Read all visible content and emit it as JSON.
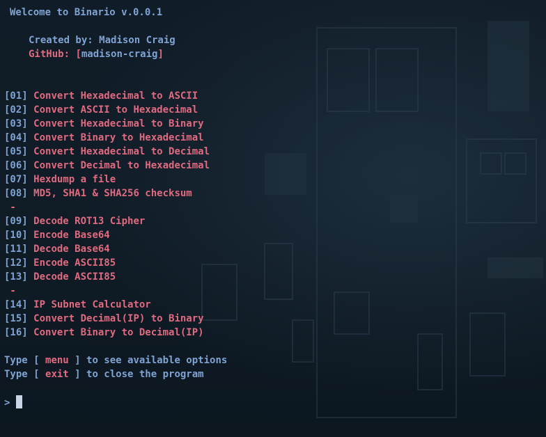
{
  "header": {
    "welcome": "Welcome to Binario v.0.0.1",
    "created_by": "Created by: Madison Craig",
    "github_label": "GitHub: ",
    "github_open": "[",
    "github_user": "madison-craig",
    "github_close": "]"
  },
  "menu": {
    "items": [
      {
        "number": "[01]",
        "label": "Convert Hexadecimal to ASCII"
      },
      {
        "number": "[02]",
        "label": "Convert ASCII to Hexadecimal"
      },
      {
        "number": "[03]",
        "label": "Convert Hexadecimal to Binary"
      },
      {
        "number": "[04]",
        "label": "Convert Binary to Hexadecimal"
      },
      {
        "number": "[05]",
        "label": "Convert Hexadecimal to Decimal"
      },
      {
        "number": "[06]",
        "label": "Convert Decimal to Hexadecimal"
      },
      {
        "number": "[07]",
        "label": "Hexdump a file"
      },
      {
        "number": "[08]",
        "label": "MD5, SHA1 & SHA256 checksum"
      },
      {
        "number": "[09]",
        "label": "Decode ROT13 Cipher"
      },
      {
        "number": "[10]",
        "label": "Encode Base64"
      },
      {
        "number": "[11]",
        "label": "Decode Base64"
      },
      {
        "number": "[12]",
        "label": "Encode ASCII85"
      },
      {
        "number": "[13]",
        "label": "Decode ASCII85"
      },
      {
        "number": "[14]",
        "label": "IP Subnet Calculator"
      },
      {
        "number": "[15]",
        "label": "Convert Decimal(IP) to Binary"
      },
      {
        "number": "[16]",
        "label": "Convert Binary to Decimal(IP)"
      }
    ],
    "separator": " -"
  },
  "help": {
    "menu_hint": {
      "pre": "Type [ ",
      "cmd": "menu",
      "post": " ] to see available options"
    },
    "exit_hint": {
      "pre": "Type [ ",
      "cmd": "exit",
      "post": " ] to close the program"
    }
  },
  "prompt": {
    "symbol": ">",
    "value": ""
  },
  "colors": {
    "background": "#0e1a24",
    "accent_blue": "#7fa3d2",
    "accent_pink": "#e06a80",
    "cursor": "#c7d5e6"
  }
}
